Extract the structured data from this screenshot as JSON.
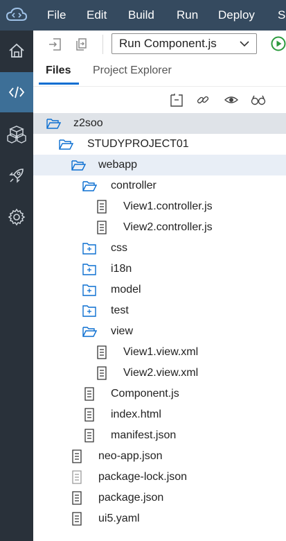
{
  "menubar": {
    "logo_icon": "sap-cloud-code-icon",
    "items": [
      "File",
      "Edit",
      "Build",
      "Run",
      "Deploy",
      "S"
    ]
  },
  "sidebar": {
    "items": [
      {
        "icon": "home-icon",
        "active": false
      },
      {
        "icon": "code-icon",
        "active": true
      },
      {
        "icon": "cubes-icon",
        "active": false
      },
      {
        "icon": "rocket-icon",
        "active": false
      },
      {
        "icon": "gear-icon",
        "active": false
      }
    ]
  },
  "toolbar": {
    "run_config": "Run Component.js",
    "icons": [
      "import-icon",
      "export-icon",
      "chevron-down-icon",
      "run-icon"
    ]
  },
  "tabs": [
    {
      "label": "Files",
      "active": true
    },
    {
      "label": "Project Explorer",
      "active": false
    }
  ],
  "actions": [
    "collapse-all-icon",
    "link-icon",
    "show-hidden-icon",
    "search-glasses-icon"
  ],
  "tree": [
    {
      "label": "z2soo",
      "type": "folder-open",
      "depth": 0,
      "selected": "dark"
    },
    {
      "label": "STUDYPROJECT01",
      "type": "folder-open",
      "depth": 1
    },
    {
      "label": "webapp",
      "type": "folder-open",
      "depth": 2,
      "selected": "light"
    },
    {
      "label": "controller",
      "type": "folder-open",
      "depth": 3
    },
    {
      "label": "View1.controller.js",
      "type": "file",
      "depth": 4
    },
    {
      "label": "View2.controller.js",
      "type": "file",
      "depth": 4
    },
    {
      "label": "css",
      "type": "folder-closed",
      "depth": 3
    },
    {
      "label": "i18n",
      "type": "folder-closed",
      "depth": 3
    },
    {
      "label": "model",
      "type": "folder-closed",
      "depth": 3
    },
    {
      "label": "test",
      "type": "folder-closed",
      "depth": 3
    },
    {
      "label": "view",
      "type": "folder-open",
      "depth": 3
    },
    {
      "label": "View1.view.xml",
      "type": "file",
      "depth": 4
    },
    {
      "label": "View2.view.xml",
      "type": "file",
      "depth": 4
    },
    {
      "label": "Component.js",
      "type": "file",
      "depth": 3
    },
    {
      "label": "index.html",
      "type": "file",
      "depth": 3
    },
    {
      "label": "manifest.json",
      "type": "file",
      "depth": 3
    },
    {
      "label": "neo-app.json",
      "type": "file",
      "depth": 2
    },
    {
      "label": "package-lock.json",
      "type": "file-light",
      "depth": 2
    },
    {
      "label": "package.json",
      "type": "file",
      "depth": 2
    },
    {
      "label": "ui5.yaml",
      "type": "file",
      "depth": 2
    }
  ]
}
